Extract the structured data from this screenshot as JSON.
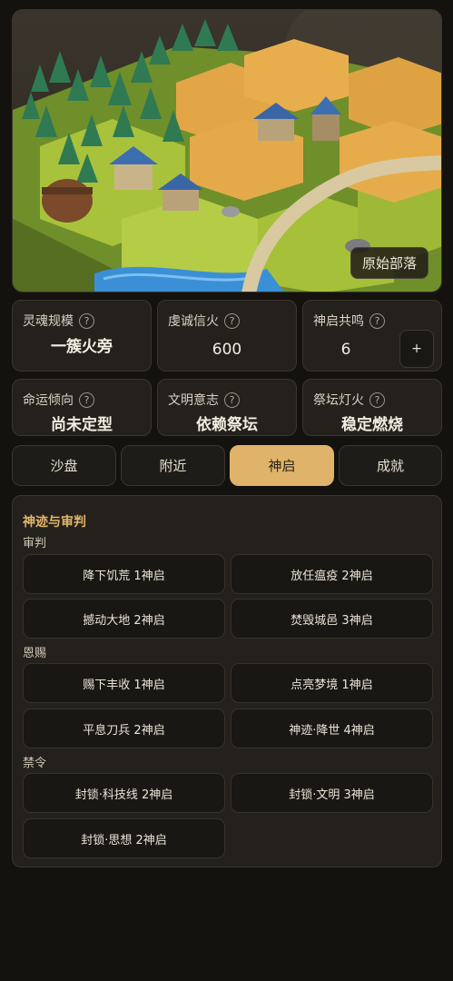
{
  "scene": {
    "label": "原始部落"
  },
  "stats": [
    {
      "label": "灵魂规模",
      "value": "一簇火旁"
    },
    {
      "label": "虔诚信火",
      "value": "600"
    },
    {
      "label": "神启共鸣",
      "value": "6",
      "button": "+"
    },
    {
      "label": "命运倾向",
      "value": "尚未定型"
    },
    {
      "label": "文明意志",
      "value": "依赖祭坛"
    },
    {
      "label": "祭坛灯火",
      "value": "稳定燃烧"
    }
  ],
  "help_glyph": "?",
  "tabs": [
    "沙盘",
    "附近",
    "神启",
    "成就"
  ],
  "active_tab": "神启",
  "panel": {
    "title": "神迹与审判",
    "sections": [
      {
        "label": "审判",
        "actions": [
          "降下饥荒 1神启",
          "放任瘟疫 2神启",
          "撼动大地 2神启",
          "焚毁城邑 3神启"
        ]
      },
      {
        "label": "恩赐",
        "actions": [
          "赐下丰收 1神启",
          "点亮梦境 1神启",
          "平息刀兵 2神启",
          "神迹·降世 4神启"
        ]
      },
      {
        "label": "禁令",
        "actions": [
          "封锁·科技线 2神启",
          "封锁·文明 3神启",
          "封锁·思想 2神启"
        ]
      }
    ]
  },
  "colors": {
    "accent": "#e0b36a",
    "background": "#14120f",
    "card": "#24211d"
  }
}
